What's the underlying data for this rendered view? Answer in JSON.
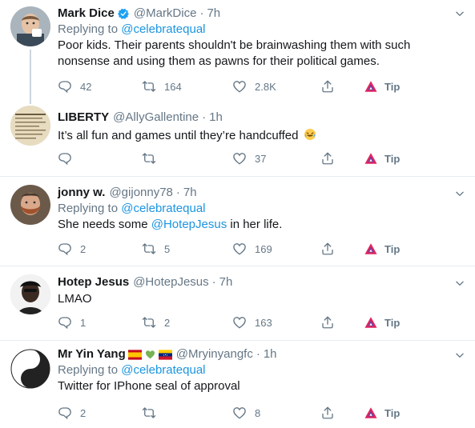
{
  "tweets": [
    {
      "name": "Mark Dice",
      "verified": true,
      "handle": "@MarkDice",
      "time": "7h",
      "reply_prefix": "Replying to",
      "reply_to": "@celebratequal",
      "text": "Poor kids.  Their parents shouldn't be brainwashing them with such nonsense and using them as pawns for their political games.",
      "replies": "42",
      "retweets": "164",
      "likes": "2.8K",
      "tip": "Tip"
    },
    {
      "name": "LIBERTY",
      "handle": "@AllyGallentine",
      "time": "1h",
      "text": "It’s all fun and games until they’re handcuffed",
      "emoji": "rolling-laughing",
      "replies": "",
      "retweets": "",
      "likes": "37",
      "tip": "Tip"
    },
    {
      "name": "jonny w.",
      "handle": "@gijonny78",
      "time": "7h",
      "reply_prefix": "Replying to",
      "reply_to": "@celebratequal",
      "text_before": "She needs some",
      "mention": "@HotepJesus",
      "text_after": "in her life.",
      "replies": "2",
      "retweets": "5",
      "likes": "169",
      "tip": "Tip"
    },
    {
      "name": "Hotep Jesus",
      "handle": "@HotepJesus",
      "time": "7h",
      "text": "LMAO",
      "replies": "1",
      "retweets": "2",
      "likes": "163",
      "tip": "Tip"
    },
    {
      "name": "Mr Yin Yang",
      "name_emojis": [
        "spain-flag",
        "green-heart",
        "venezuela-flag"
      ],
      "handle": "@Mryinyangfc",
      "time": "1h",
      "reply_prefix": "Replying to",
      "reply_to": "@celebratequal",
      "text": "Twitter for IPhone seal of approval",
      "replies": "2",
      "retweets": "",
      "likes": "8",
      "tip": "Tip"
    }
  ],
  "separator": "·",
  "colors": {
    "link": "#1b95e0",
    "muted": "#657786",
    "text": "#14171a",
    "border": "#e6ecf0",
    "tip_red": "#e0245e",
    "tip_purple": "#6b3fa0"
  }
}
